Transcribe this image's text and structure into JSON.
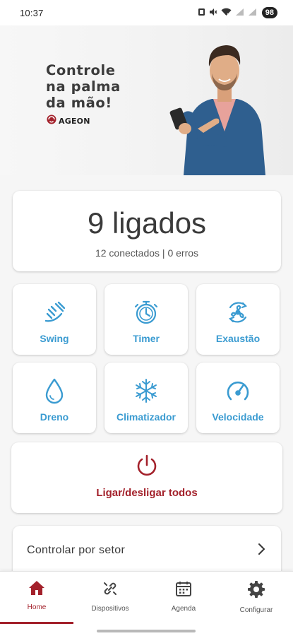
{
  "status_bar": {
    "time": "10:37",
    "battery": "98"
  },
  "banner": {
    "headline": "Controle\nna palma\nda mão!",
    "brand": "AGEON"
  },
  "summary": {
    "title": "9 ligados",
    "subtitle": "12 conectados | 0 erros"
  },
  "actions": [
    {
      "label": "Swing",
      "icon": "swing-icon"
    },
    {
      "label": "Timer",
      "icon": "timer-icon"
    },
    {
      "label": "Exaustão",
      "icon": "exhaust-fan-icon"
    },
    {
      "label": "Dreno",
      "icon": "drop-icon"
    },
    {
      "label": "Climatizador",
      "icon": "snowflake-icon"
    },
    {
      "label": "Velocidade",
      "icon": "speedometer-icon"
    }
  ],
  "power_all": {
    "label": "Ligar/desligar todos",
    "icon": "power-icon"
  },
  "sector": {
    "label": "Controlar por setor",
    "icon": "chevron-right-icon"
  },
  "nav": {
    "items": [
      {
        "label": "Home",
        "icon": "home-icon",
        "active": true
      },
      {
        "label": "Dispositivos",
        "icon": "link-icon",
        "active": false
      },
      {
        "label": "Agenda",
        "icon": "calendar-icon",
        "active": false
      },
      {
        "label": "Configurar",
        "icon": "gear-icon",
        "active": false
      }
    ]
  },
  "colors": {
    "accent_blue": "#3a9bd1",
    "brand_red": "#a3212b",
    "text_dark": "#3a3a3a"
  }
}
